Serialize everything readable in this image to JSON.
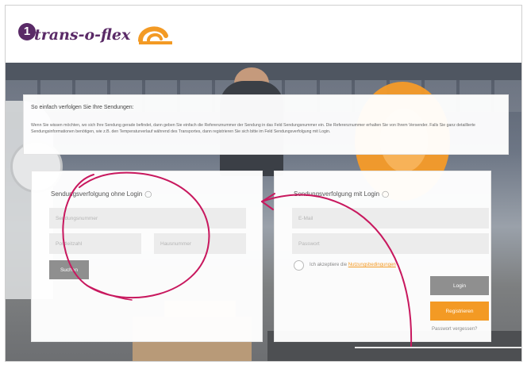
{
  "header": {
    "step_number": "1",
    "logo_text": "trans-o-flex",
    "logo_mark": "trans-o-flex-swoosh-icon"
  },
  "info": {
    "title": "So einfach verfolgen Sie Ihre Sendungen:",
    "text": "Wenn Sie wissen möchten, wo sich Ihre Sendung gerade befindet, dann geben Sie einfach die Referenznummer der Sendung in das Feld Sendungsnummer ein. Die Referenznummer erhalten Sie von Ihrem Versender. Falls Sie ganz detaillierte Sendungsinformationen benötigen, wie z.B. den Temperaturverlauf während des Transportes, dann registrieren Sie sich bitte im Feld Sendungsverfolgung mit Login."
  },
  "tracking_no_login": {
    "title": "Sendungsverfolgung ohne Login",
    "shipment_number_placeholder": "Sendungsnummer",
    "postal_code_placeholder": "Postleitzahl",
    "house_number_placeholder": "Hausnummer",
    "search_label": "Suchen"
  },
  "tracking_login": {
    "title": "Sendungsverfolgung mit Login",
    "email_placeholder": "E-Mail",
    "password_placeholder": "Passwort",
    "terms_prefix": "Ich akzeptiere die",
    "terms_link": "Nutzungsbedingungen",
    "login_label": "Login",
    "register_label": "Registrieren",
    "forgot_password": "Passwort vergessen?"
  },
  "colors": {
    "brand_purple": "#5a2a67",
    "brand_orange": "#f39a24",
    "button_gray": "#8f8f8f",
    "annotation_magenta": "#c8185e"
  }
}
